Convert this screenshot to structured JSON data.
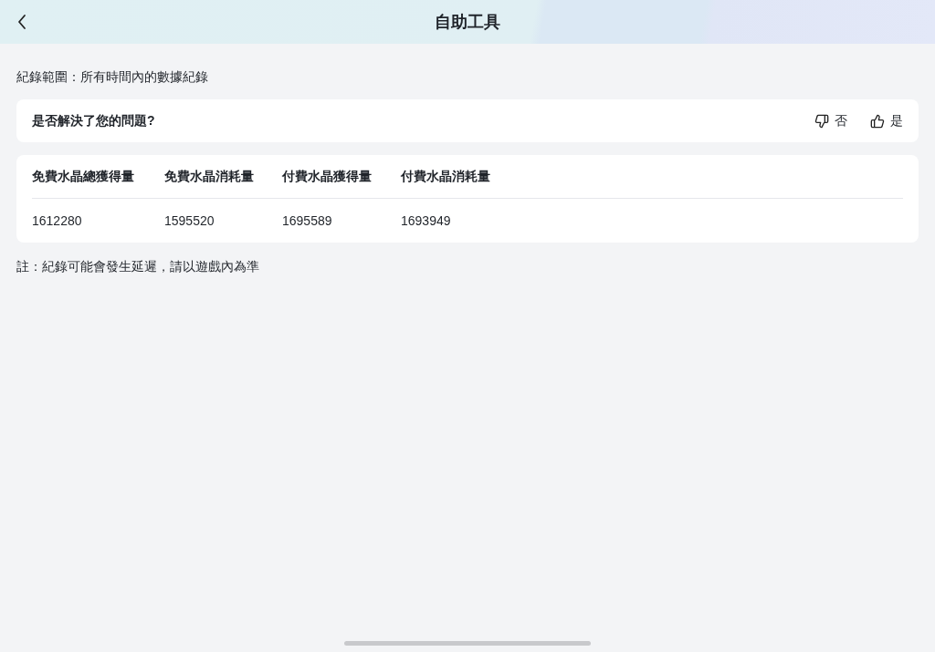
{
  "header": {
    "title": "自助工具"
  },
  "range_text": "紀錄範圍：所有時間內的數據紀錄",
  "feedback": {
    "question": "是否解決了您的問題?",
    "no_label": "否",
    "yes_label": "是"
  },
  "table": {
    "columns": [
      "免費水晶總獲得量",
      "免費水晶消耗量",
      "付費水晶獲得量",
      "付費水晶消耗量"
    ],
    "rows": [
      [
        "1612280",
        "1595520",
        "1695589",
        "1693949"
      ]
    ]
  },
  "note": "註：紀錄可能會發生延遲，請以遊戲內為準"
}
